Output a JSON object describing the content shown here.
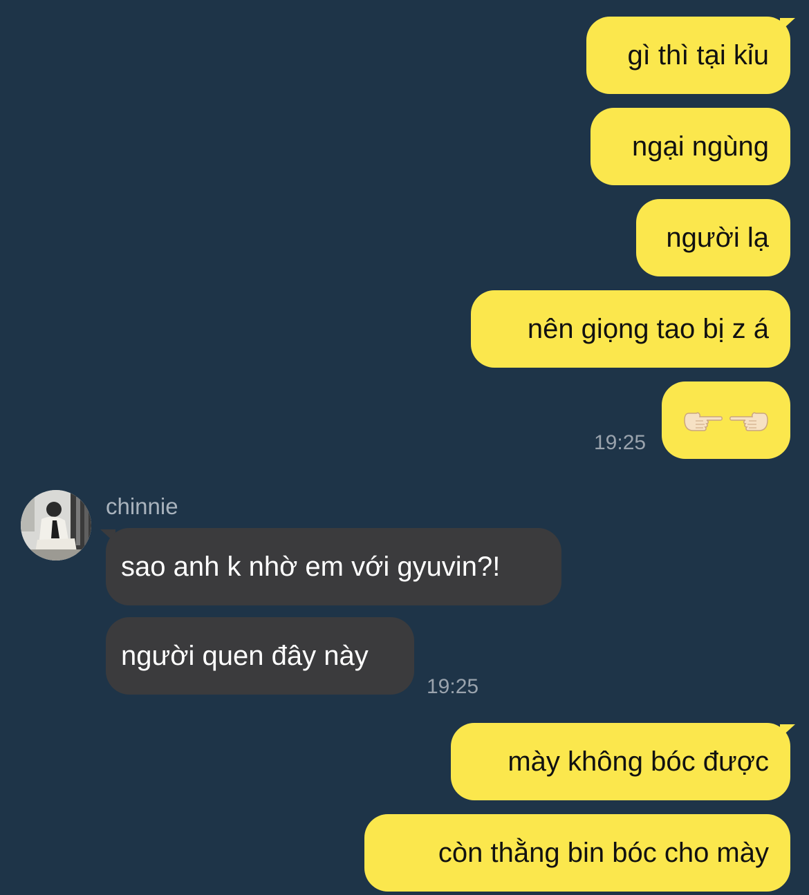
{
  "chat": {
    "messages": [
      {
        "side": "out",
        "text": "gì thì tại kỉu"
      },
      {
        "side": "out",
        "text": "ngại ngùng"
      },
      {
        "side": "out",
        "text": "người lạ"
      },
      {
        "side": "out",
        "text": "nên giọng tao bị z á"
      },
      {
        "side": "out",
        "emoji": [
          "pointing-right-hand",
          "pointing-left-hand"
        ],
        "time": "19:25"
      },
      {
        "side": "in",
        "sender": "chinnie",
        "text": "sao anh k nhờ em với gyuvin?!"
      },
      {
        "side": "in",
        "text": "người quen đây này",
        "time": "19:25"
      },
      {
        "side": "out",
        "text": "mày không bóc được"
      },
      {
        "side": "out",
        "text": "còn thằng bin bóc cho mày"
      }
    ]
  },
  "colors": {
    "background": "#1e3448",
    "outgoing_bubble": "#fbe74d",
    "incoming_bubble": "#3b3b3d",
    "timestamp": "#9aa3ad"
  }
}
